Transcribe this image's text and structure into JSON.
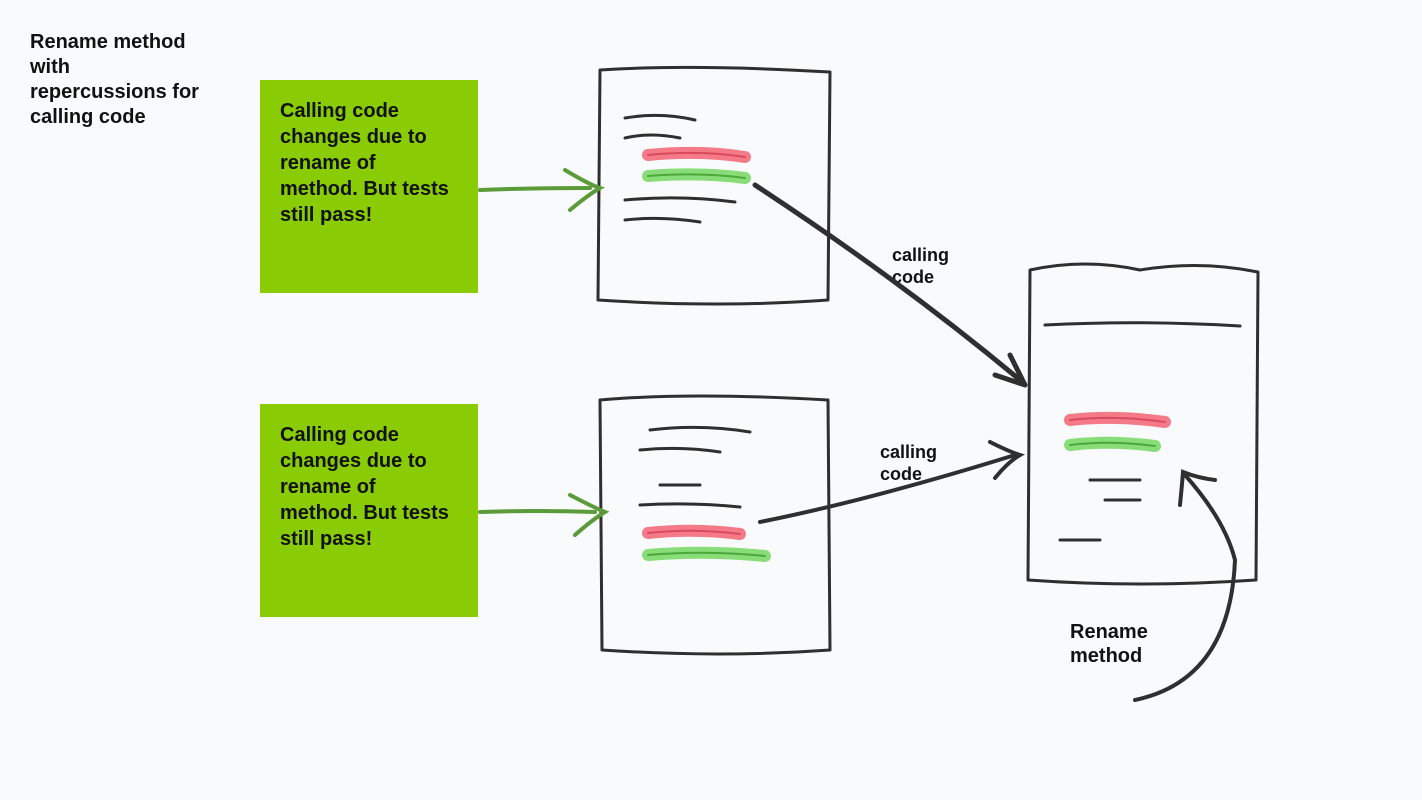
{
  "title": "Rename method with repercussions for calling code",
  "green_box_1": "Calling code changes due to rename of method. But tests still pass!",
  "green_box_2": "Calling code changes due to rename of method. But tests still pass!",
  "arrow_label_1": "calling code",
  "arrow_label_2": "calling code",
  "target_label": "Rename method",
  "colors": {
    "green_box": "#89cc04",
    "highlight_red": "#f36c7b",
    "highlight_green": "#7cd96a",
    "ink": "#2f2f2f",
    "arrow_green": "#5b9b3a"
  }
}
